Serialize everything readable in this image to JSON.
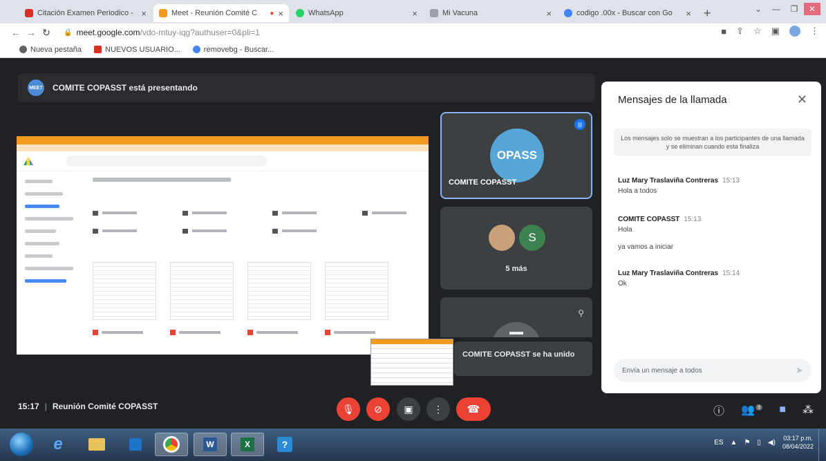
{
  "browser": {
    "tabs": [
      {
        "label": "Citación Examen Periodico - ",
        "color": "#d93025"
      },
      {
        "label": "Meet - Reunión Comité C",
        "color": "#f29a1f",
        "active": true
      },
      {
        "label": "WhatsApp",
        "color": "#25d366"
      },
      {
        "label": "Mi Vacuna",
        "color": "#9aa0a6"
      },
      {
        "label": "codigo .00x - Buscar con Go",
        "color": "#4285f4"
      }
    ],
    "new_tab": "+",
    "url_host": "meet.google.com",
    "url_path": "/vdo-mtuy-iqg?authuser=0&pli=1",
    "bookmarks": [
      {
        "label": "Nueva pestaña",
        "color": "#5f6368"
      },
      {
        "label": "NUEVOS USUARIO...",
        "color": "#d93025"
      },
      {
        "label": "removebg - Buscar...",
        "color": "#4285f4"
      }
    ]
  },
  "meet": {
    "presenting_banner": "COMITE COPASST está presentando",
    "presenter_avatar": "MEET",
    "main_tile": {
      "avatar_text": "OPASS",
      "name": "COMITE COPASST"
    },
    "more_tile": {
      "avatar_letter": "S",
      "label": "5 más"
    },
    "joined_toast": "COMITE COPASST se ha unido",
    "time": "15:17",
    "meeting_name": "Reunión Comité COPASST",
    "participants_count": "8"
  },
  "chat": {
    "title": "Mensajes de la llamada",
    "notice": "Los mensajes solo se muestran a los participantes de una llamada y se eliminan cuando esta finaliza",
    "messages": [
      {
        "sender": "Luz Mary Traslaviña Contreras",
        "time": "15:13",
        "lines": [
          "Hola a todos"
        ]
      },
      {
        "sender": "COMITE COPASST",
        "time": "15:13",
        "lines": [
          "Hola",
          "ya vamos a iniciar"
        ]
      },
      {
        "sender": "Luz Mary Traslaviña Contreras",
        "time": "15:14",
        "lines": [
          "Ok"
        ]
      }
    ],
    "input_placeholder": "Envía un mensaje a todos"
  },
  "taskbar": {
    "time": "03:17 p.m.",
    "date": "08/04/2022",
    "apps": [
      "ie",
      "explorer",
      "outlook",
      "chrome",
      "word",
      "excel",
      "help"
    ]
  },
  "colors": {
    "meet_bg": "#202124",
    "accent_red": "#ea4335",
    "chat_bg": "#ffffff"
  }
}
